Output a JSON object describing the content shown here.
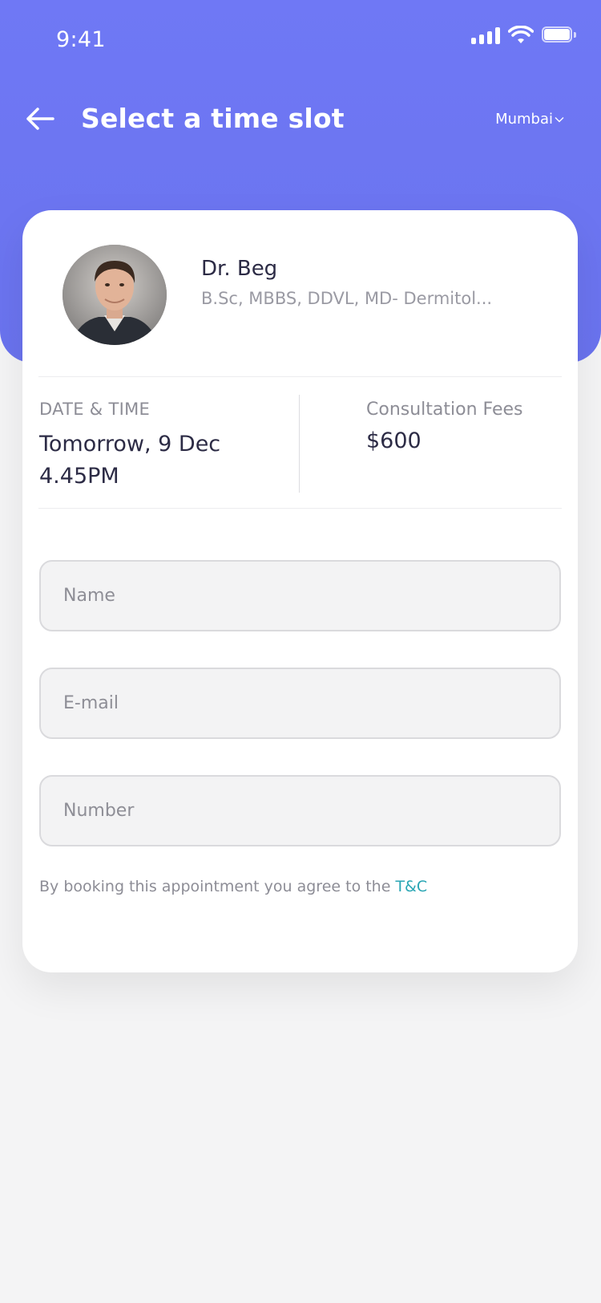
{
  "status_bar": {
    "time": "9:41",
    "icons": [
      "signal-icon",
      "wifi-icon",
      "battery-icon"
    ]
  },
  "header": {
    "title": "Select a time slot",
    "city": "Mumbai",
    "back_icon": "arrow-left-icon",
    "dropdown_icon": "chevron-down-icon"
  },
  "doctor": {
    "name": "Dr. Beg",
    "qualifications": "B.Sc, MBBS, DDVL, MD- Dermitol..."
  },
  "appointment": {
    "datetime_label": "DATE & TIME",
    "date": "Tomorrow, 9 Dec",
    "time": "4.45PM",
    "fees_label": "Consultation Fees",
    "fees_value": "$600"
  },
  "form": {
    "name_placeholder": "Name",
    "email_placeholder": "E-mail",
    "number_placeholder": "Number"
  },
  "terms": {
    "text": "By booking this appointment you agree to the ",
    "link": "T&C"
  },
  "colors": {
    "primary": "#6f78f5",
    "link": "#2aa6b4",
    "text_dark": "#2c2b45",
    "text_muted": "#8d8d96",
    "background": "#f4f4f5"
  }
}
